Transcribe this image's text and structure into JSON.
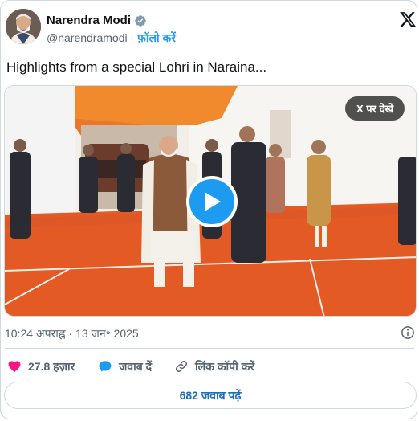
{
  "author": {
    "name": "Narendra Modi",
    "handle": "@narendramodi",
    "separator": "·",
    "follow_label": "फ़ॉलो करें"
  },
  "tweet": {
    "text": "Highlights from a special Lohri in Naraina..."
  },
  "media": {
    "view_on_x_label": "X पर देखें"
  },
  "meta": {
    "timestamp": "10:24 अपराह्न · 13 जन॰ 2025"
  },
  "actions": {
    "likes": "27.8 हज़ार",
    "reply_label": "जवाब दें",
    "copy_link_label": "लिंक कॉपी करें"
  },
  "read_replies_label": "682 जवाब पढ़ें",
  "colors": {
    "accent": "#1d9bf0",
    "like": "#f91880",
    "text": "#0f1419",
    "muted": "#536471",
    "border": "#cfd9de"
  },
  "icons": [
    "verified-badge-icon",
    "x-logo-icon",
    "play-icon",
    "info-icon",
    "heart-icon",
    "speech-bubble-icon",
    "link-icon"
  ]
}
